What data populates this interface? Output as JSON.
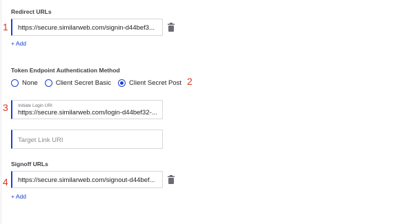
{
  "redirect_urls": {
    "label": "Redirect URLs",
    "value": "https://secure.similarweb.com/signin-d44bef3...",
    "add_label": "+ Add"
  },
  "token_auth": {
    "label": "Token Endpoint Authentication Method",
    "options": [
      "None",
      "Client Secret Basic",
      "Client Secret Post"
    ],
    "selected": "Client Secret Post"
  },
  "initiate_login": {
    "label": "Initiate Login URI",
    "value": "https://secure.similarweb.com/login-d44bef32-..."
  },
  "target_link": {
    "placeholder": "Target Link URI"
  },
  "signoff_urls": {
    "label": "Signoff URLs",
    "value": "https://secure.similarweb.com/signout-d44bef...",
    "add_label": "+ Add"
  },
  "annotations": [
    "1",
    "2",
    "3",
    "4"
  ],
  "colors": {
    "accent": "#1a3fd1",
    "annotation": "#e0341c"
  },
  "icons": {
    "delete": "trash-icon"
  }
}
